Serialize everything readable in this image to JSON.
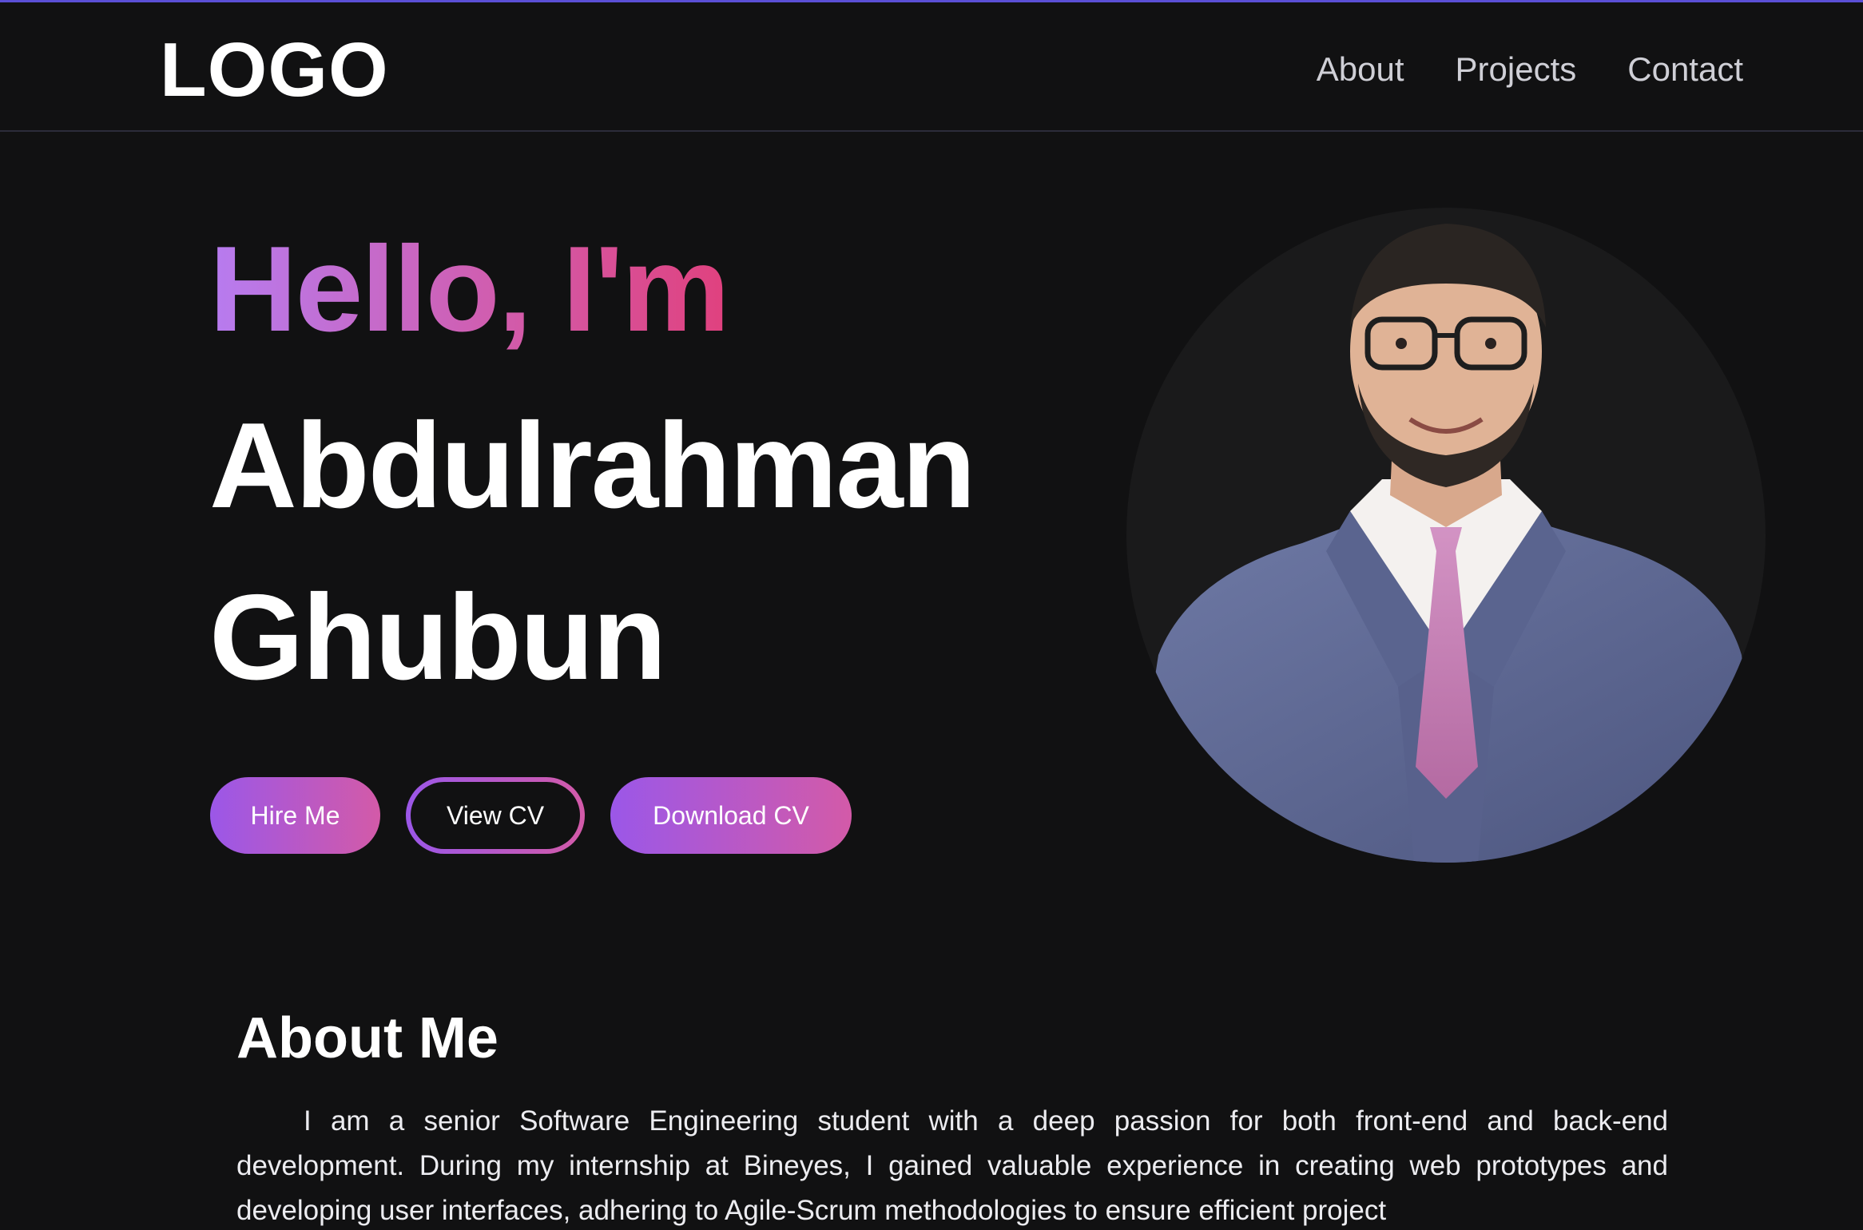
{
  "nav": {
    "logo": "LOGO",
    "links": [
      "About",
      "Projects",
      "Contact"
    ]
  },
  "hero": {
    "greeting": "Hello, I'm",
    "first_name": "Abdulrahman",
    "last_name": "Ghubun",
    "buttons": {
      "hire": "Hire Me",
      "view_cv": "View CV",
      "download_cv": "Download CV"
    }
  },
  "about": {
    "title": "About Me",
    "text": "I am a senior Software Engineering student with a deep passion for both front-end and back-end development. During my internship at Bineyes, I gained valuable experience in creating web prototypes and developing user interfaces, adhering to Agile-Scrum methodologies to ensure efficient project"
  },
  "colors": {
    "background": "#111112",
    "accent_start": "#9b57e8",
    "accent_end": "#d35aa8",
    "top_accent": "#5b4fd6"
  }
}
